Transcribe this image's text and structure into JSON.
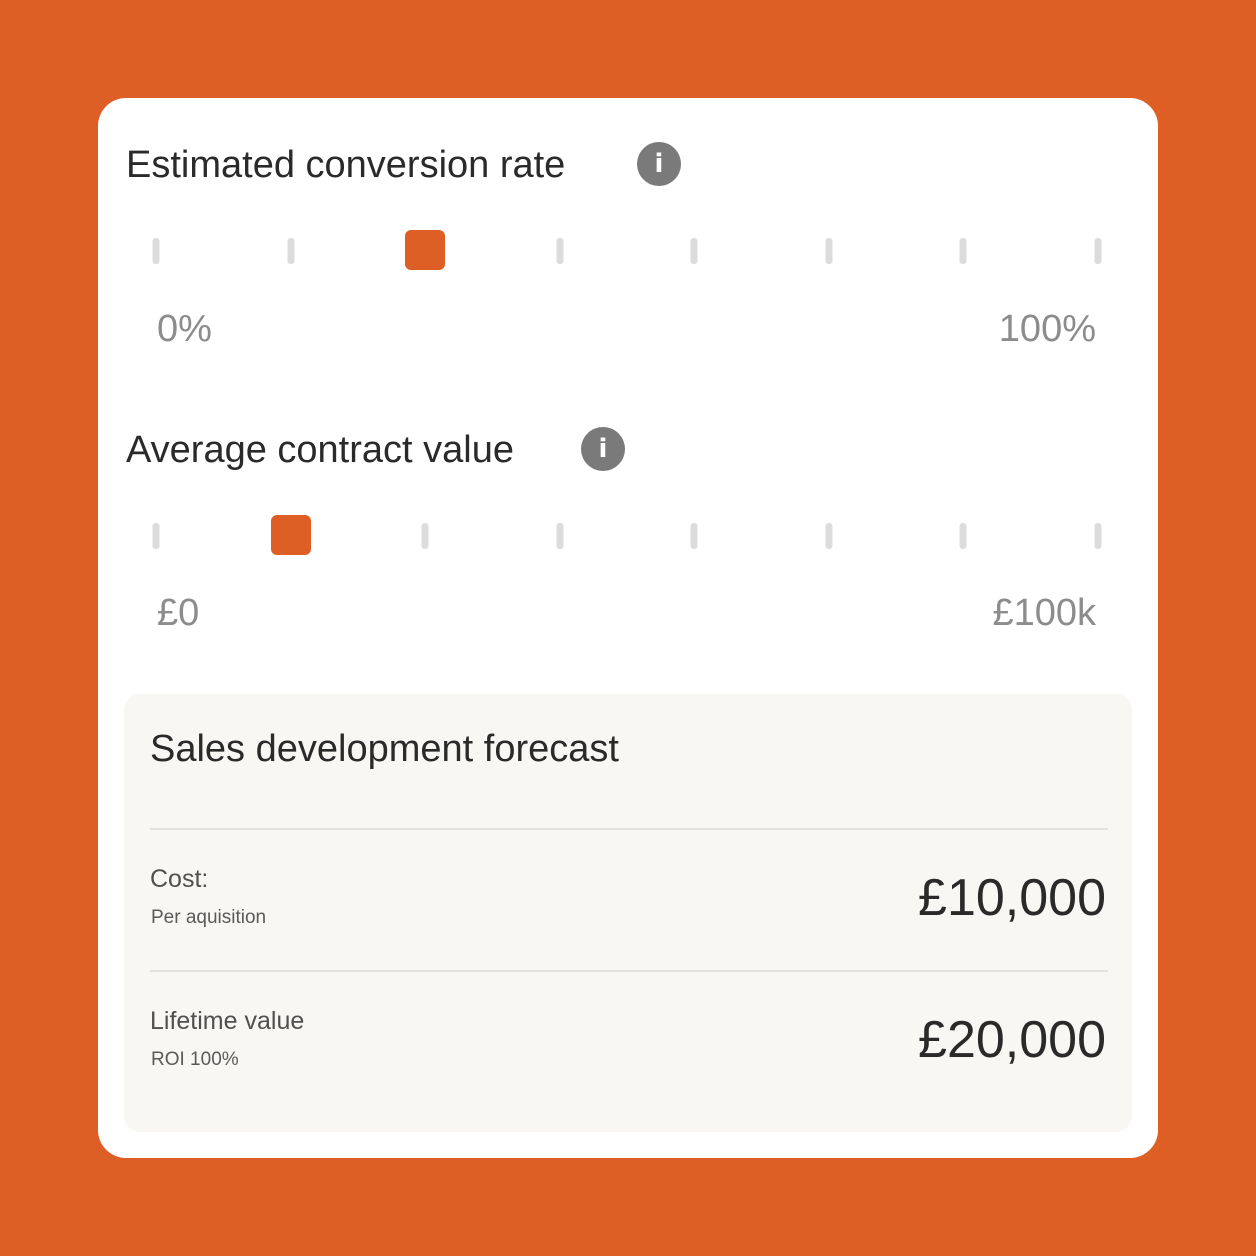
{
  "colors": {
    "background": "#DD5F25",
    "accent": "#DD5F25",
    "card": "#FFFFFF",
    "panel": "#F8F7F4",
    "tick": "#DCDCDC",
    "info_icon": "#7A7A7A"
  },
  "conversion": {
    "title": "Estimated conversion rate",
    "info_icon": "info-icon",
    "info_glyph": "i",
    "min_label": "0%",
    "max_label": "100%",
    "tick_count": 8,
    "selected_stop_index": 2
  },
  "contract": {
    "title": "Average contract value",
    "info_icon": "info-icon",
    "info_glyph": "i",
    "min_label": "£0",
    "max_label": "£100k",
    "tick_count": 8,
    "selected_stop_index": 1
  },
  "forecast": {
    "title": "Sales development forecast",
    "rows": [
      {
        "label": "Cost:",
        "sublabel": "Per aquisition",
        "value": "£10,000"
      },
      {
        "label": "Lifetime value",
        "sublabel": "ROI 100%",
        "value": "£20,000"
      }
    ]
  }
}
